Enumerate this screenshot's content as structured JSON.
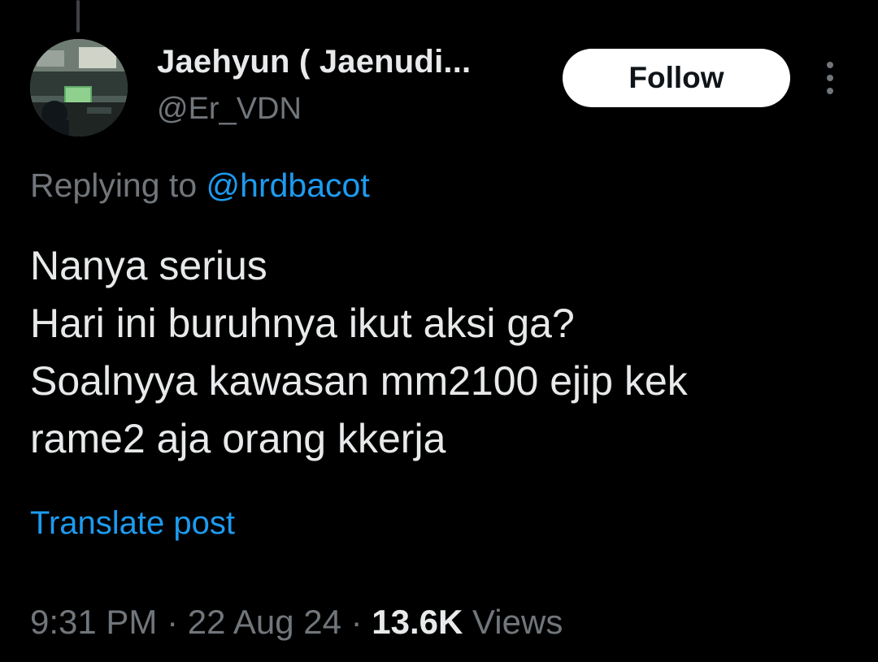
{
  "author": {
    "display_name": "Jaehyun ( Jaenudi...",
    "handle": "@Er_VDN"
  },
  "follow_button": {
    "label": "Follow"
  },
  "more_menu": {
    "icon": "more-vertical-icon"
  },
  "reply_context": {
    "prefix": "Replying to",
    "mention": "@hrdbacot"
  },
  "post": {
    "lines": [
      "Nanya serius",
      "Hari ini buruhnya ikut aksi ga?",
      "Soalnyya kawasan mm2100 ejip kek",
      "rame2 aja orang kkerja"
    ]
  },
  "translate_link": "Translate post",
  "meta": {
    "time": "9:31 PM",
    "separator": "·",
    "date": "22 Aug 24",
    "views_count": "13.6K",
    "views_label": "Views"
  },
  "colors": {
    "background": "#000000",
    "primary_text": "#e7e9ea",
    "secondary_text": "#71767b",
    "accent": "#1d9bf0",
    "follow_button_bg": "#ffffff"
  }
}
